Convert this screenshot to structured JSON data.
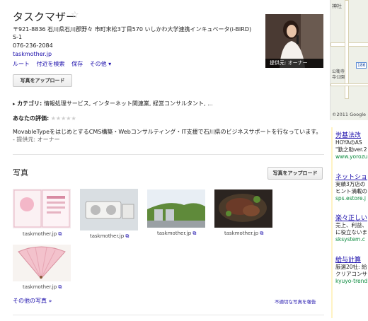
{
  "place": {
    "title": "タスクマザー",
    "star": "☆",
    "address": "〒921-8836 石川県石川郡野々 市町末松3丁目570 いしかわ大学連携インキュベータ(i-BIRD) S-1",
    "phone": "076-236-2084",
    "website": "taskmother.jp",
    "actions": [
      "ルート",
      "付近を検索",
      "保存",
      "その他 ▾"
    ],
    "upload_label": "写真をアップロード",
    "category_label": "カテゴリ:",
    "category_value": "情報処理サービス, インターネット関連業, 経営コンサルタント, ...",
    "rating_label": "あなたの評価:",
    "rating_stars": "★★★★★",
    "description": "MovableTypeをはじめとするCMS構築・Webコンサルティング・IT支援で石川県のビジネスサポートを行なっています。",
    "description_source": "- 提供元: オーナー"
  },
  "main_photo": {
    "caption": "提供元: オーナー"
  },
  "map": {
    "labels": [
      "神社",
      "公衛寺",
      "寺公園",
      "©2011 Google"
    ],
    "route_badge": "186"
  },
  "photos": {
    "heading": "写真",
    "upload_label": "写真をアップロード",
    "items": [
      {
        "caption": "taskmother.jp"
      },
      {
        "caption": "taskmother.jp"
      },
      {
        "caption": "taskmother.jp"
      },
      {
        "caption": "taskmother.jp"
      },
      {
        "caption": "taskmother.jp"
      }
    ],
    "more_link": "その他の写真 »",
    "report_link": "不適切な写真を報告"
  },
  "ads": [
    {
      "headline": "労基法改",
      "lines": [
        "HOYAのAS",
        "\"勤之助ver.2"
      ],
      "url": "www.yorozu"
    },
    {
      "headline": "ネットショ",
      "lines": [
        "実績3万店の",
        "ヒント満載の"
      ],
      "url": "sps.estore.j"
    },
    {
      "headline": "楽々正しい",
      "lines": [
        "売上、利益、",
        "に役立ないま"
      ],
      "url": "sksystem.c"
    },
    {
      "headline": "給与計算",
      "lines": [
        "厳選20社: 給",
        "クリアコンサ"
      ],
      "url": "kyuyo-trend"
    }
  ]
}
